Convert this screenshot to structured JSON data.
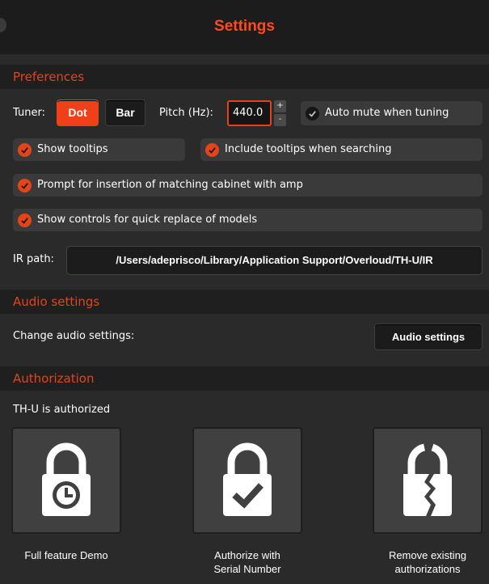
{
  "title": "Settings",
  "preferences": {
    "header": "Preferences",
    "tuner_label": "Tuner:",
    "tuner_options": [
      "Dot",
      "Bar"
    ],
    "tuner_selected": "Dot",
    "pitch_label": "Pitch (Hz):",
    "pitch_value": "440.0",
    "stepper_up": "+",
    "stepper_down": "-",
    "auto_mute": {
      "label": "Auto mute when tuning",
      "checked": false
    },
    "show_tooltips": {
      "label": "Show tooltips",
      "checked": true
    },
    "include_tooltips": {
      "label": "Include tooltips when searching",
      "checked": true
    },
    "prompt_cabinet": {
      "label": "Prompt for insertion of matching cabinet with amp",
      "checked": true
    },
    "quick_replace": {
      "label": "Show controls for quick replace of models",
      "checked": true
    },
    "ir_path_label": "IR path:",
    "ir_path_value": "/Users/adeprisco/Library/Application Support/Overloud/TH-U/IR"
  },
  "audio": {
    "header": "Audio settings",
    "change_label": "Change audio settings:",
    "button_label": "Audio settings"
  },
  "authorization": {
    "header": "Authorization",
    "status": "TH-U is authorized",
    "cards": [
      {
        "label_line1": "Full feature Demo",
        "label_line2": "",
        "icon": "lock-clock-icon"
      },
      {
        "label_line1": "Authorize with",
        "label_line2": "Serial Number",
        "icon": "lock-check-icon"
      },
      {
        "label_line1": "Remove existing",
        "label_line2": "authorizations",
        "icon": "broken-lock-icon"
      }
    ]
  },
  "colors": {
    "accent": "#e54418",
    "title": "#ff4a1c",
    "background": "#2a2a2a",
    "header_bg": "#1f1f1f"
  }
}
